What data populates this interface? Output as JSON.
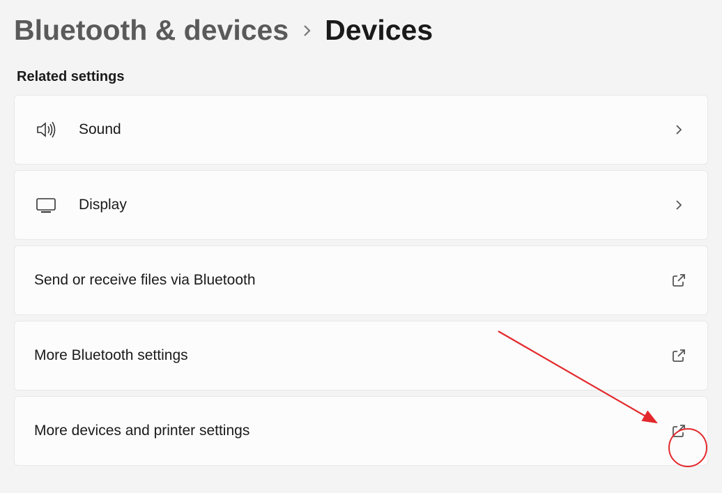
{
  "breadcrumb": {
    "parent": "Bluetooth & devices",
    "current": "Devices"
  },
  "section_title": "Related settings",
  "items": [
    {
      "label": "Sound",
      "icon": "sound",
      "action": "chevron"
    },
    {
      "label": "Display",
      "icon": "display",
      "action": "chevron"
    },
    {
      "label": "Send or receive files via Bluetooth",
      "icon": "",
      "action": "external"
    },
    {
      "label": "More Bluetooth settings",
      "icon": "",
      "action": "external"
    },
    {
      "label": "More devices and printer settings",
      "icon": "",
      "action": "external"
    }
  ],
  "annotation": {
    "color": "#e3282c"
  }
}
